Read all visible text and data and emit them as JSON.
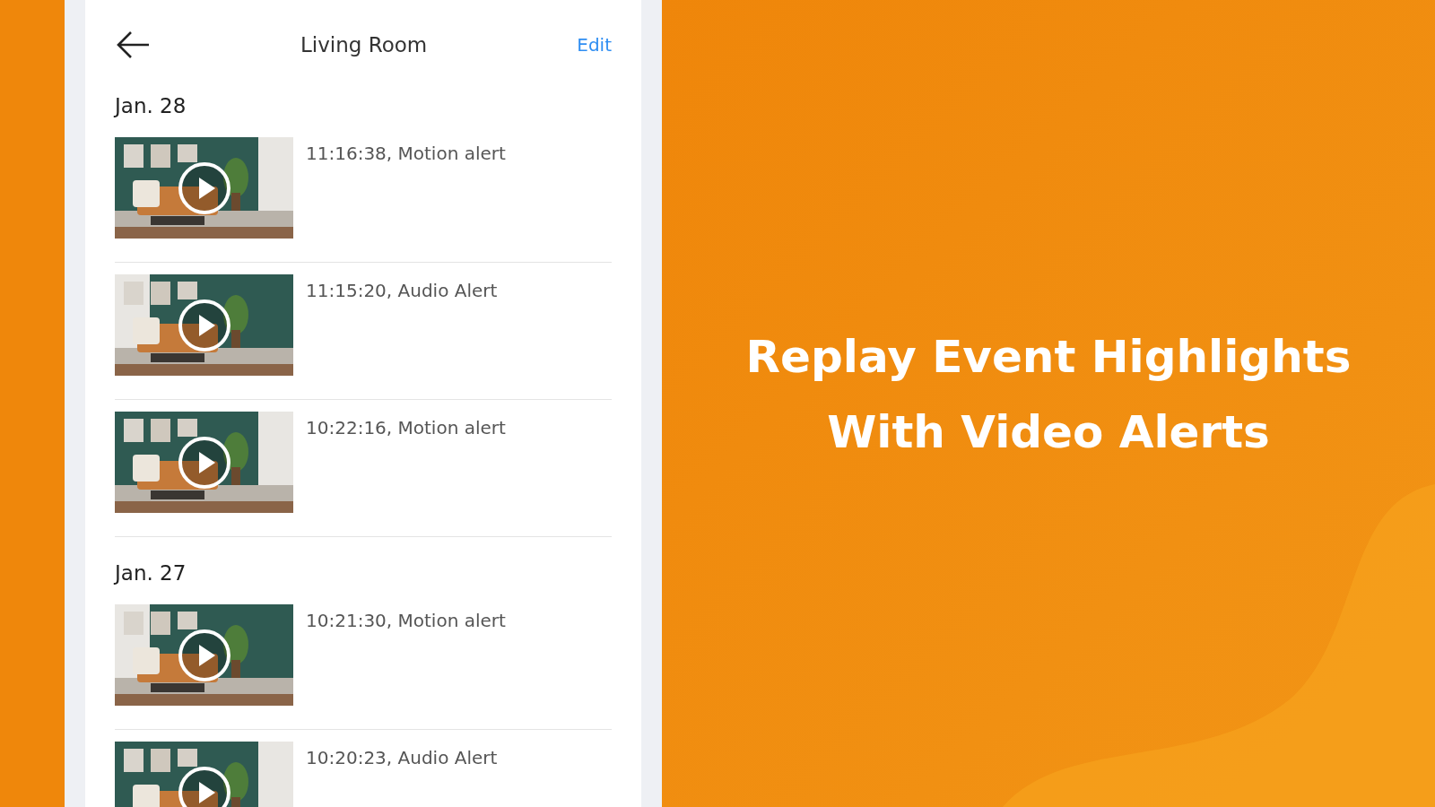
{
  "header": {
    "title": "Living Room",
    "action": "Edit"
  },
  "groups": [
    {
      "date": "Jan. 28",
      "events": [
        {
          "text": "11:16:38, Motion alert"
        },
        {
          "text": "11:15:20, Audio Alert"
        },
        {
          "text": "10:22:16, Motion alert"
        }
      ]
    },
    {
      "date": "Jan. 27",
      "events": [
        {
          "text": "10:21:30, Motion alert"
        },
        {
          "text": "10:20:23, Audio Alert"
        }
      ]
    }
  ],
  "headline": [
    "Replay Event Highlights",
    "With Video Alerts"
  ]
}
